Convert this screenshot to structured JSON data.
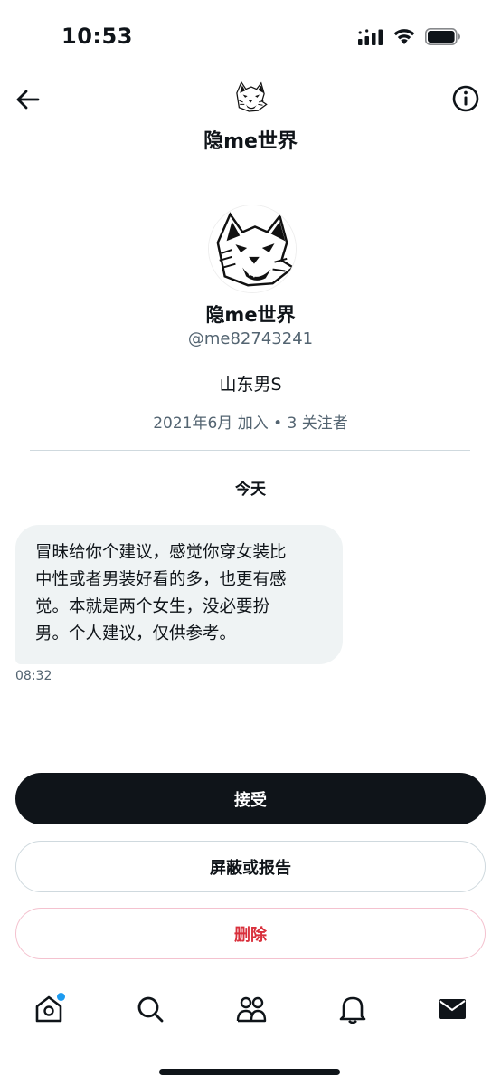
{
  "status_bar": {
    "time": "10:53"
  },
  "header": {
    "title": "隐me世界",
    "back_icon": "arrow-left-icon",
    "info_icon": "info-circle-icon"
  },
  "profile": {
    "name": "隐me世界",
    "handle": "@me82743241",
    "bio": "山东男S",
    "meta": "2021年6月 加入 • 3 关注者"
  },
  "conversation": {
    "date_label": "今天",
    "messages": [
      {
        "lines": [
          "冒昧给你个建议，感觉你穿女装比",
          "中性或者男装好看的多，也更有感",
          "觉。本就是两个女生，没必要扮",
          "男。个人建议，仅供参考。"
        ],
        "time": "08:32"
      }
    ]
  },
  "actions": {
    "accept": "接受",
    "block_report": "屏蔽或报告",
    "delete": "删除"
  },
  "colors": {
    "primary": "#0f1419",
    "secondary_text": "#536471",
    "bubble": "#eff3f4",
    "danger": "#d9303c",
    "notification_dot": "#1d9bf0"
  },
  "bottom_nav": {
    "items": [
      "home-icon",
      "search-icon",
      "communities-icon",
      "notifications-bell-icon",
      "messages-envelope-icon"
    ]
  }
}
